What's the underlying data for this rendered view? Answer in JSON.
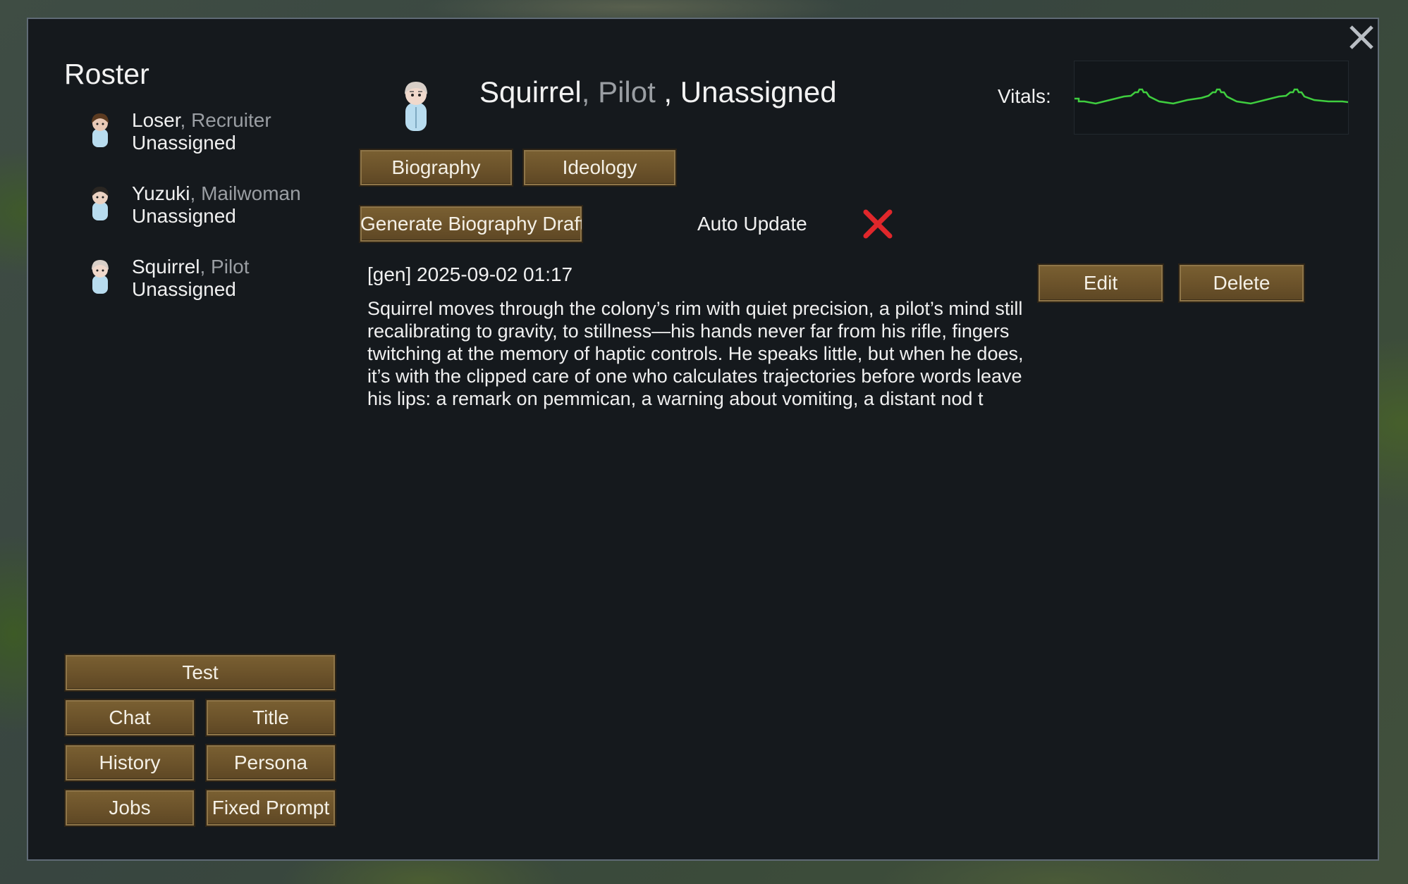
{
  "window": {
    "close_icon": "close-icon"
  },
  "roster": {
    "title": "Roster",
    "items": [
      {
        "name": "Loser",
        "separator": ", ",
        "role": "Recruiter",
        "status": "Unassigned",
        "avatar_hair": "#5b3a20"
      },
      {
        "name": "Yuzuki",
        "separator": ", ",
        "role": "Mailwoman",
        "status": "Unassigned",
        "avatar_hair": "#2a2622"
      },
      {
        "name": "Squirrel",
        "separator": ", ",
        "role": "Pilot",
        "status": "Unassigned",
        "avatar_hair": "#d8cfc8"
      }
    ]
  },
  "header": {
    "name": "Squirrel",
    "sep1": ", ",
    "role": "Pilot",
    "sep2": " , ",
    "status": "Unassigned",
    "vitals_label": "Vitals:"
  },
  "tabs": {
    "biography": "Biography",
    "ideology": "Ideology"
  },
  "actions": {
    "generate": "Generate Biography Draft",
    "auto_update_label": "Auto Update",
    "auto_update_enabled": false
  },
  "entry": {
    "header": "[gen] 2025-09-02 01:17",
    "body": "Squirrel moves through the colony’s rim with quiet precision, a pilot’s mind still recalibrating to gravity, to stillness—his hands never far from his rifle, fingers twitching at the memory of haptic controls. He speaks little, but when he does, it’s with the clipped care of one who calculates trajectories before words leave his lips: a remark on pemmican, a warning about vomiting, a distant nod t",
    "edit": "Edit",
    "delete": "Delete"
  },
  "bottom_buttons": {
    "test": "Test",
    "chat": "Chat",
    "title": "Title",
    "history": "History",
    "persona": "Persona",
    "jobs": "Jobs",
    "fixed_prompt": "Fixed Prompt"
  },
  "colors": {
    "window_bg": "#15191d",
    "button_brown": "#6b522a",
    "vitals_green": "#3fce3f",
    "toggle_red": "#e0272b"
  }
}
